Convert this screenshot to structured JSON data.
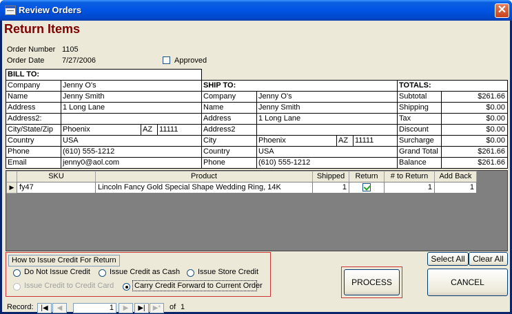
{
  "window": {
    "title": "Review Orders"
  },
  "heading": "Return Items",
  "order": {
    "number_label": "Order Number",
    "number": "1105",
    "date_label": "Order Date",
    "date": "7/27/2006",
    "approved_label": "Approved",
    "approved": false
  },
  "bill_to": {
    "header": "BILL TO:",
    "rows": [
      {
        "label": "Company",
        "value": "Jenny O's"
      },
      {
        "label": "Name",
        "value": "Jenny Smith"
      },
      {
        "label": "Address",
        "value": "1 Long Lane"
      },
      {
        "label": "Address2:",
        "value": ""
      },
      {
        "label": "City/State/Zip",
        "city": "Phoenix",
        "state": "AZ",
        "zip": "11111"
      },
      {
        "label": "Country",
        "value": "USA"
      },
      {
        "label": "Phone",
        "value": "(610) 555-1212"
      },
      {
        "label": "Email",
        "value": "jenny0@aol.com"
      }
    ]
  },
  "ship_to": {
    "header": "SHIP TO:",
    "rows": [
      {
        "label": "Company",
        "value": "Jenny O's"
      },
      {
        "label": "Name",
        "value": "Jenny Smith"
      },
      {
        "label": "Address",
        "value": "1 Long Lane"
      },
      {
        "label": "Address2",
        "value": ""
      },
      {
        "label": "City",
        "city": "Phoenix",
        "state": "AZ",
        "zip": "11111"
      },
      {
        "label": "Country",
        "value": "USA"
      },
      {
        "label": "Phone",
        "value": "(610) 555-1212"
      }
    ]
  },
  "totals": {
    "header": "TOTALS:",
    "rows": [
      {
        "label": "Subtotal",
        "value": "$261.66"
      },
      {
        "label": "Shipping",
        "value": "$0.00"
      },
      {
        "label": "Tax",
        "value": "$0.00"
      },
      {
        "label": "Discount",
        "value": "$0.00"
      },
      {
        "label": "Surcharge",
        "value": "$0.00"
      },
      {
        "label": "Grand Total",
        "value": "$261.66"
      },
      {
        "label": "Balance",
        "value": "$261.66"
      }
    ]
  },
  "items": {
    "columns": [
      "SKU",
      "Product",
      "Shipped",
      "Return",
      "# to Return",
      "Add Back"
    ],
    "rows": [
      {
        "sku": "fy47",
        "product": "Lincoln Fancy Gold Special Shape Wedding Ring, 14K",
        "shipped": "1",
        "return": true,
        "to_return": "1",
        "add_back": "1"
      }
    ]
  },
  "buttons": {
    "select_all": "Select All",
    "clear_all": "Clear All",
    "process": "PROCESS",
    "cancel": "CANCEL"
  },
  "credit": {
    "group_label": "How to Issue Credit For Return",
    "options": [
      {
        "label": "Do Not Issue Credit",
        "selected": false,
        "enabled": true
      },
      {
        "label": "Issue Credit as Cash",
        "selected": false,
        "enabled": true
      },
      {
        "label": "Issue Store Credit",
        "selected": false,
        "enabled": true
      },
      {
        "label": "Issue Credit to Credit Card",
        "selected": false,
        "enabled": false
      },
      {
        "label": "Carry Credit Forward to Current Order",
        "selected": true,
        "enabled": true
      }
    ]
  },
  "record_nav": {
    "label": "Record:",
    "current": "1",
    "of_label": "of",
    "total": "1"
  },
  "icons": {
    "close": "close-icon",
    "app": "app-icon",
    "row_selector": "row-pointer-icon"
  },
  "colors": {
    "title_bar": "#0054e3",
    "heading": "#800000",
    "highlight_border": "#cc3333"
  }
}
